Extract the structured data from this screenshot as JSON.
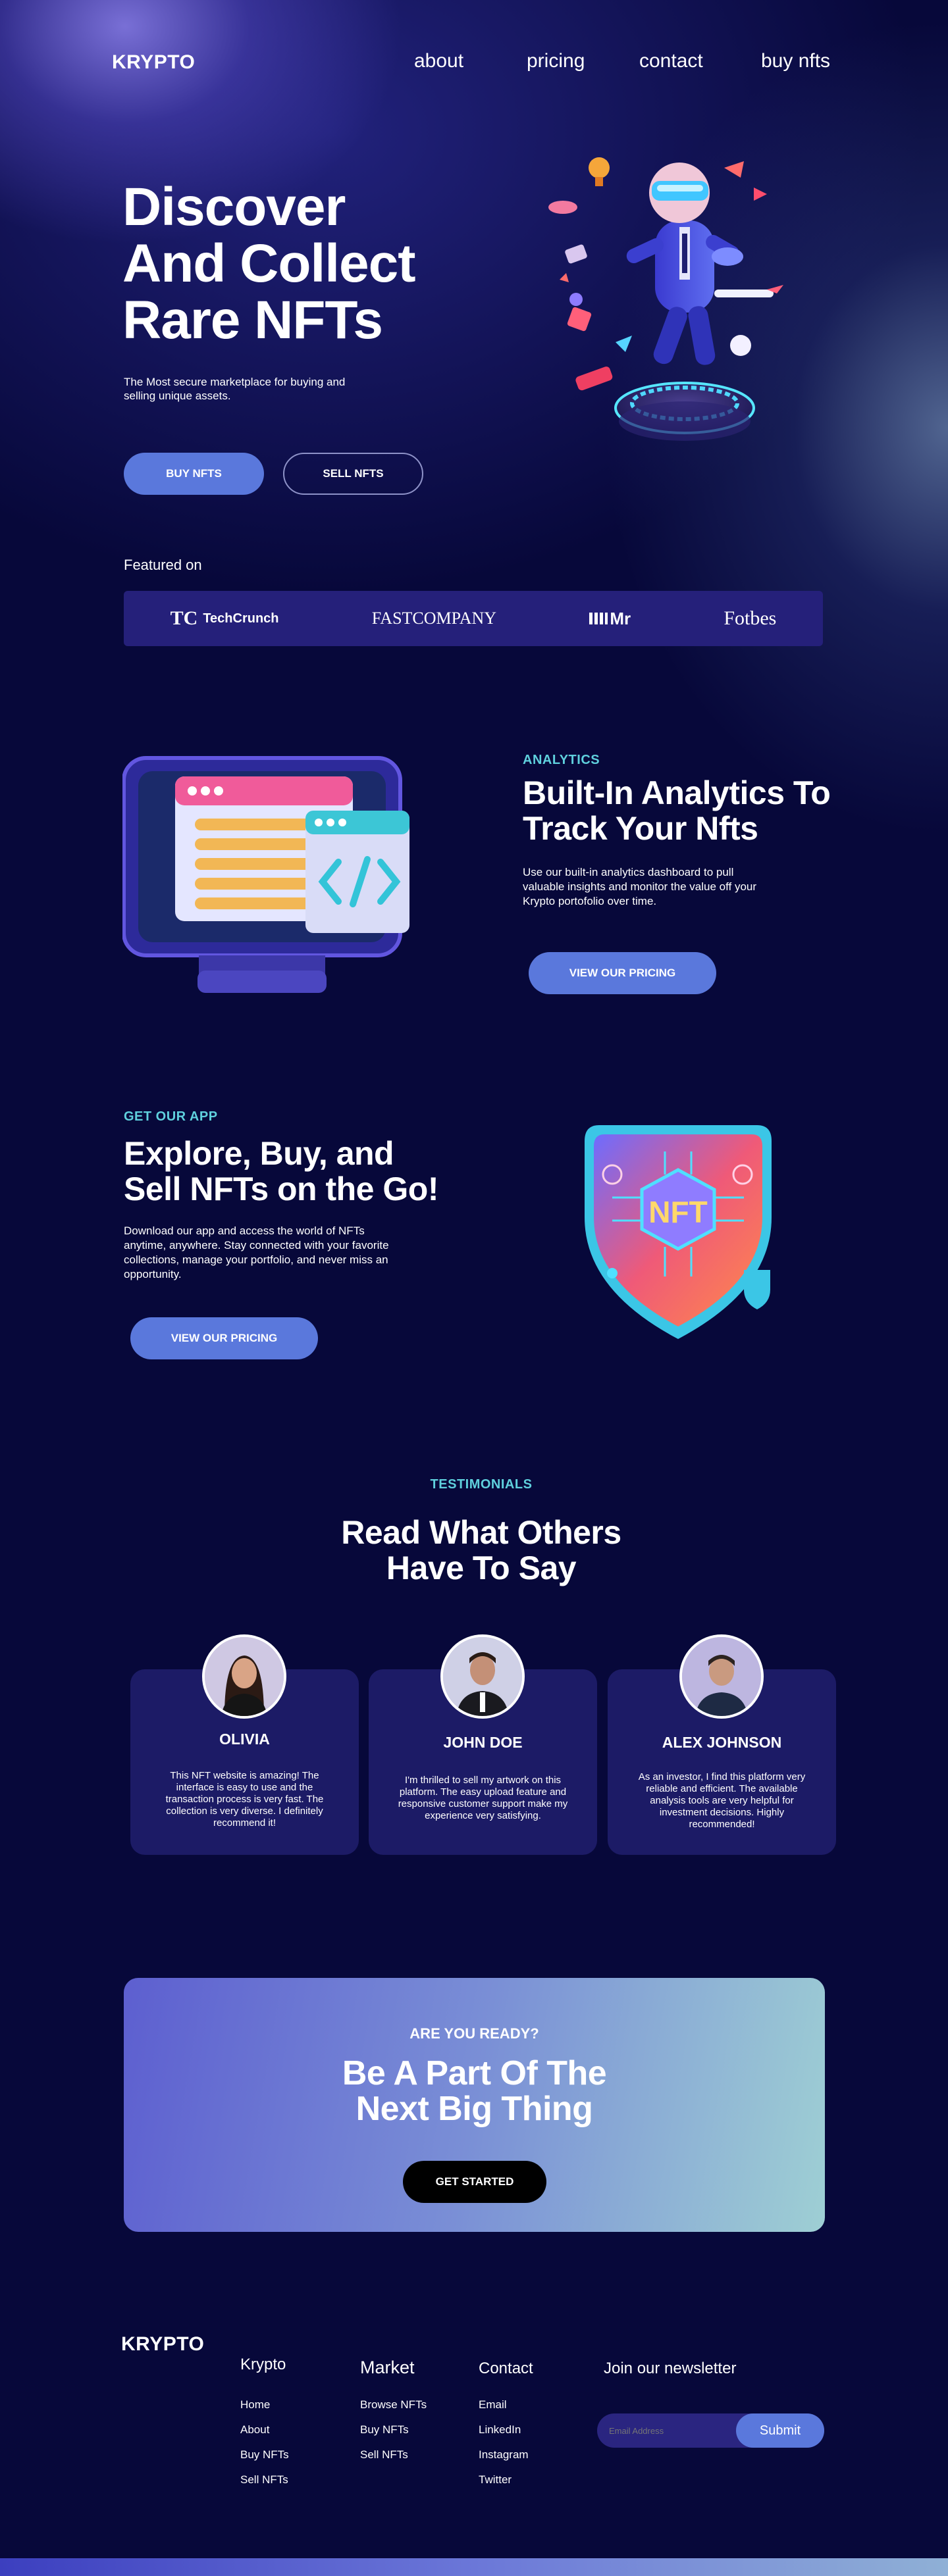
{
  "nav": {
    "logo": "KRYPTO",
    "links": [
      "about",
      "pricing",
      "contact",
      "buy nfts"
    ]
  },
  "hero": {
    "title_lines": [
      "Discover",
      "And Collect",
      "Rare NFTs"
    ],
    "subtitle": "The Most secure marketplace for buying and selling unique assets.",
    "buy_button": "BUY NFTS",
    "sell_button": "SELL NFTS",
    "featured_label": "Featured on",
    "brands": [
      "TechCrunch",
      "FASTCOMPANY",
      "Mr",
      "Fotbes"
    ]
  },
  "analytics": {
    "eyebrow": "ANALYTICS",
    "title_lines": [
      "Built-In Analytics To",
      "Track Your Nfts"
    ],
    "body": "Use our built-in analytics dashboard to pull valuable insights and monitor the value off your Krypto portofolio over time.",
    "button": "VIEW OUR PRICING"
  },
  "app": {
    "eyebrow": "GET OUR APP",
    "title_lines": [
      "Explore, Buy, and",
      "Sell NFTs on the Go!"
    ],
    "body": "Download our app and access the world of NFTs anytime, anywhere. Stay connected with your favorite collections, manage your portfolio, and never miss an opportunity.",
    "button": "VIEW OUR PRICING",
    "badge_text": "NFT"
  },
  "testimonials": {
    "eyebrow": "TESTIMONIALS",
    "title_lines": [
      "Read What Others",
      "Have To Say"
    ],
    "items": [
      {
        "name": "OLIVIA",
        "text": "This NFT website is amazing! The interface is easy to use and the transaction process is very fast. The collection is very diverse. I definitely recommend it!"
      },
      {
        "name": "JOHN DOE",
        "text": "I'm thrilled to sell my artwork on this platform. The easy upload feature and responsive customer support make my experience very satisfying."
      },
      {
        "name": "ALEX JOHNSON",
        "text": "As an investor, I find this platform very reliable and efficient. The available analysis tools are very helpful for investment decisions. Highly recommended!"
      }
    ]
  },
  "cta": {
    "eyebrow": "ARE YOU READY?",
    "title_lines": [
      "Be A Part Of The",
      "Next Big Thing"
    ],
    "button": "GET STARTED"
  },
  "footer": {
    "logo": "KRYPTO",
    "columns": [
      {
        "heading": "Krypto",
        "links": [
          "Home",
          "About",
          "Buy NFTs",
          "Sell NFTs"
        ]
      },
      {
        "heading": "Market",
        "links": [
          "Browse NFTs",
          "Buy NFTs",
          "Sell NFTs"
        ]
      },
      {
        "heading": "Contact",
        "links": [
          "Email",
          "LinkedIn",
          "Instagram",
          "Twitter"
        ]
      }
    ],
    "newsletter_heading": "Join our newsletter",
    "email_placeholder": "Email Address",
    "submit": "Submit"
  },
  "colors": {
    "background": "#07083a",
    "accent_blue": "#5a78dc",
    "eyebrow_cyan": "#5fd0dd",
    "card": "#1c1b66"
  }
}
